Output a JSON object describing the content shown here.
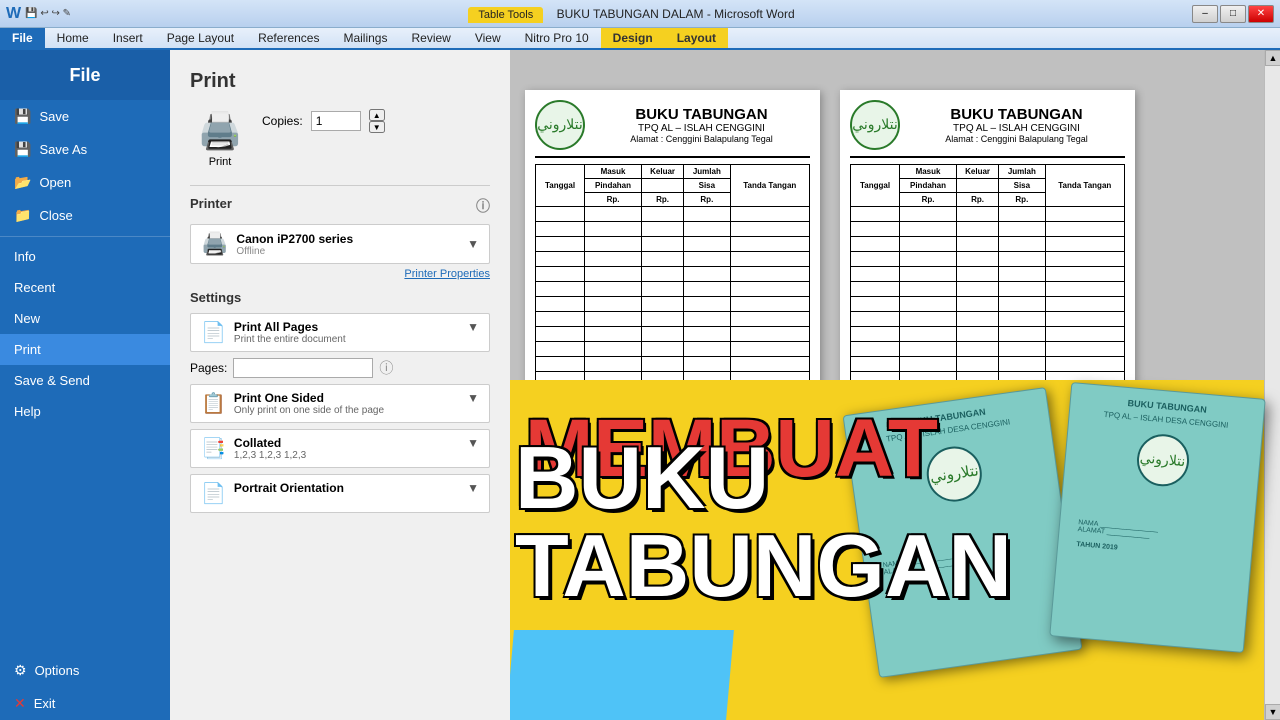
{
  "titlebar": {
    "title": "BUKU TABUNGAN DALAM - Microsoft Word",
    "table_tools": "Table Tools",
    "min": "–",
    "max": "□",
    "close": "✕"
  },
  "ribbon": {
    "tabs": [
      "File",
      "Home",
      "Insert",
      "Page Layout",
      "References",
      "Mailings",
      "Review",
      "View",
      "Nitro Pro 10",
      "Design",
      "Layout"
    ]
  },
  "filemenu": {
    "items": [
      {
        "id": "save",
        "label": "Save",
        "icon": "💾"
      },
      {
        "id": "save-as",
        "label": "Save As",
        "icon": "💾"
      },
      {
        "id": "open",
        "label": "Open",
        "icon": "📂"
      },
      {
        "id": "close",
        "label": "Close",
        "icon": "📁"
      },
      {
        "id": "info",
        "label": "Info",
        "icon": ""
      },
      {
        "id": "recent",
        "label": "Recent",
        "icon": ""
      },
      {
        "id": "new",
        "label": "New",
        "icon": ""
      },
      {
        "id": "print",
        "label": "Print",
        "icon": ""
      },
      {
        "id": "save-send",
        "label": "Save & Send",
        "icon": ""
      },
      {
        "id": "help",
        "label": "Help",
        "icon": ""
      },
      {
        "id": "options",
        "label": "Options",
        "icon": "⚙"
      },
      {
        "id": "exit",
        "label": "Exit",
        "icon": "✕"
      }
    ]
  },
  "print_panel": {
    "title": "Print",
    "copies_label": "Copies:",
    "copies_value": "1",
    "printer_section": "Printer",
    "printer_name": "Canon iP2700 series",
    "printer_status": "Offline",
    "printer_properties": "Printer Properties",
    "settings_section": "Settings",
    "print_all_pages_title": "Print All Pages",
    "print_all_pages_sub": "Print the entire document",
    "pages_label": "Pages:",
    "pages_value": "",
    "one_sided_title": "Print One Sided",
    "one_sided_sub": "Only print on one side of the page",
    "collated_title": "Collated",
    "collated_sub": "1,2,3  1,2,3  1,2,3",
    "portrait_title": "Portrait Orientation"
  },
  "preview": {
    "page1": {
      "title": "BUKU TABUNGAN",
      "subtitle": "TPQ AL – ISLAH CENGGINI",
      "address": "Alamat : Cenggini Balapulang Tegal",
      "columns": [
        "Tanggal",
        "Masuk\nPindahan\nRp.",
        "Keluar\nRp.",
        "Jumlah\nSisa\nRp.",
        "Tanda\nTangan"
      ]
    },
    "page2": {
      "title": "BUKU TABUNGAN",
      "subtitle": "TPQ AL – ISLAH CENGGINI",
      "address": "Alamat : Cenggini Balapulang Tegal",
      "columns": [
        "Tanggal",
        "Masuk\nPindahan\nRp.",
        "Keluar\nRp.",
        "Jumlah\nSisa\nRp.",
        "Tanda\nTangan"
      ]
    }
  },
  "overlay": {
    "red_text": "MEMBUAT",
    "white_text": "BUKU TABUNGAN",
    "booklet1": {
      "title": "BUKU TABUNGAN",
      "subtitle": "TPQ AL – ISLAH DESA CENGGINI",
      "bottom_labels": [
        "NAMA",
        "ALAMAT"
      ]
    },
    "booklet2": {
      "title": "BUKU TABUNGAN",
      "subtitle": "TPQ AL – ISLAH DESA CENGGINI",
      "bottom_labels": [
        "NAMA",
        "ALAMAT"
      ],
      "year": "TAHUN 2019"
    }
  }
}
